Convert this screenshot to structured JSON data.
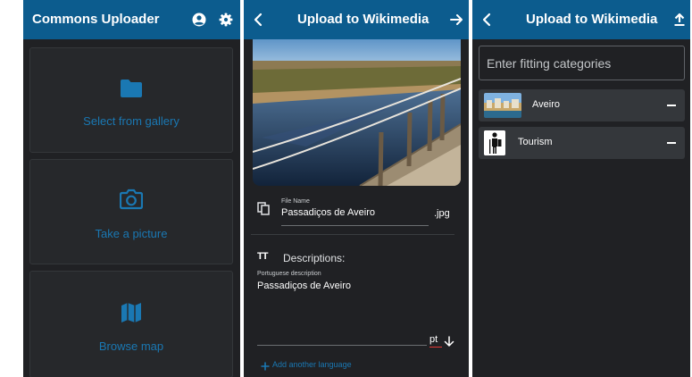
{
  "screens": {
    "home": {
      "title": "Commons Uploader",
      "icons": [
        "account-icon",
        "gear-icon"
      ],
      "cards": [
        {
          "label": "Select from gallery",
          "icon": "folder-icon"
        },
        {
          "label": "Take a picture",
          "icon": "camera-icon"
        },
        {
          "label": "Browse map",
          "icon": "map-icon"
        }
      ]
    },
    "details": {
      "title": "Upload to Wikimedia",
      "file_name_label": "File Name",
      "file_name": "Passadiços de Aveiro",
      "extension": ".jpg",
      "descriptions_heading": "Descriptions:",
      "description_label": "Portuguese description",
      "description_value": "Passadiços de Aveiro",
      "language_code": "pt",
      "add_language": "Add another language"
    },
    "categories": {
      "title": "Upload to Wikimedia",
      "input_placeholder": "Enter fitting categories",
      "items": [
        {
          "name": "Aveiro"
        },
        {
          "name": "Tourism"
        }
      ]
    }
  },
  "colors": {
    "appbar": "#0c5c8e",
    "background": "#202124",
    "accent": "#1a78b3",
    "spellcheck_underline": "#e53935"
  }
}
